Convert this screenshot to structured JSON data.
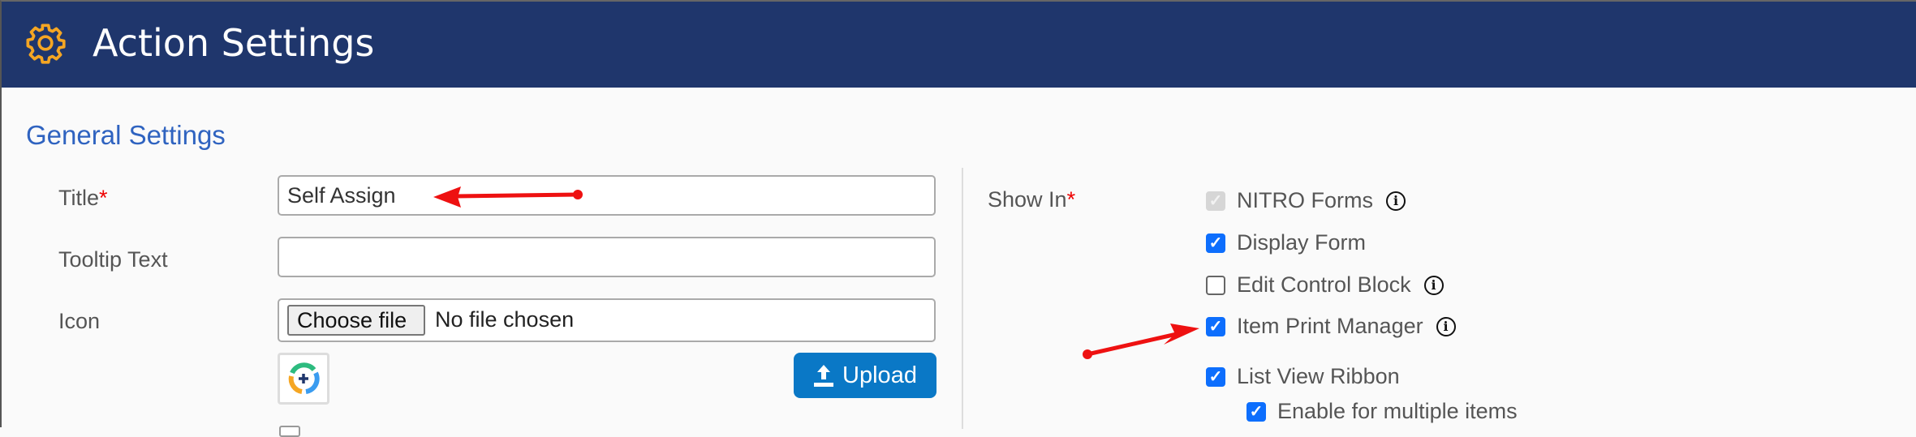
{
  "header": {
    "title": "Action Settings",
    "icon": "gear-icon",
    "background_color": "#1f366c",
    "icon_color": "#f5a623"
  },
  "general_settings": {
    "section_title": "General Settings",
    "title_field": {
      "label": "Title",
      "required_mark": "*",
      "value": "Self Assign"
    },
    "tooltip_field": {
      "label": "Tooltip Text",
      "value": ""
    },
    "icon_field": {
      "label": "Icon",
      "choose_file_label": "Choose file",
      "file_status": "No file chosen",
      "preview_icon": "circular-arrows-plus-icon",
      "upload_label": "Upload",
      "upload_icon": "upload-arrow-icon"
    }
  },
  "show_in": {
    "label": "Show In",
    "required_mark": "*",
    "options": [
      {
        "label": "NITRO Forms",
        "checked": true,
        "disabled": true,
        "info": true
      },
      {
        "label": "Display Form",
        "checked": true,
        "disabled": false,
        "info": false
      },
      {
        "label": "Edit Control Block",
        "checked": false,
        "disabled": false,
        "info": true
      },
      {
        "label": "Item Print Manager",
        "checked": true,
        "disabled": false,
        "info": true
      },
      {
        "label": "List View Ribbon",
        "checked": true,
        "disabled": false,
        "info": false
      },
      {
        "label": "Enable for multiple items",
        "checked": true,
        "disabled": false,
        "info": false,
        "indented": true
      }
    ]
  },
  "annotations": {
    "arrow_color": "#ee1111",
    "arrows": [
      "points-to-title-value",
      "points-to-item-print-manager-checkbox"
    ]
  },
  "colors": {
    "section_title": "#2f63c0",
    "checkbox_checked": "#0d6efd",
    "upload_button": "#0a78c6",
    "required": "#ee0000"
  }
}
